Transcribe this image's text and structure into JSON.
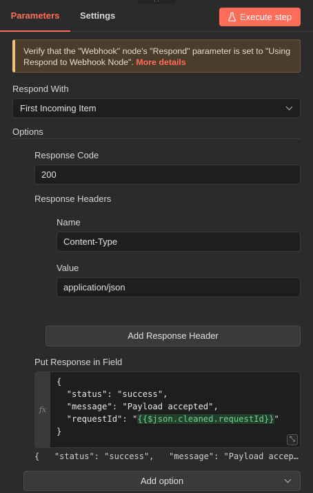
{
  "tabs": [
    {
      "label": "Parameters",
      "active": true
    },
    {
      "label": "Settings",
      "active": false
    }
  ],
  "execute_button": {
    "label": "Execute step",
    "icon": "flask-icon"
  },
  "notice": {
    "text": "Verify that the \"Webhook\" node's \"Respond\" parameter is set to \"Using Respond to Webhook Node\".",
    "link": "More details"
  },
  "respond_with": {
    "label": "Respond With",
    "value": "First Incoming Item"
  },
  "options": {
    "label": "Options",
    "response_code": {
      "label": "Response Code",
      "value": "200"
    },
    "response_headers": {
      "label": "Response Headers",
      "name_label": "Name",
      "name_value": "Content-Type",
      "value_label": "Value",
      "value_value": "application/json",
      "add_button": "Add Response Header"
    },
    "put_response": {
      "label": "Put Response in Field",
      "fx": "fx",
      "code_lines": {
        "l1": "{",
        "l2": "  \"status\": \"success\",",
        "l3": "  \"message\": \"Payload accepted\",",
        "l4_prefix": "  \"requestId\": \"",
        "l4_expr": "{{$json.cleaned.requestId}}",
        "l4_suffix": "\"",
        "l5": "}"
      },
      "preview": "{   \"status\": \"success\",   \"message\": \"Payload accep…"
    },
    "add_option": "Add option"
  },
  "colors": {
    "accent": "#ff6d5a",
    "background": "#2b2b2b",
    "notice_bg": "#4a3d2b",
    "expression": "#6dd28f"
  }
}
